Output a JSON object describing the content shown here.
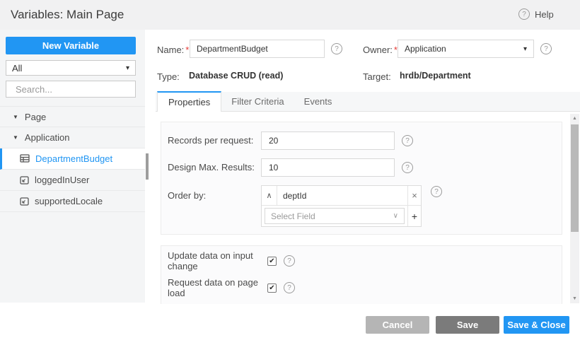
{
  "icons": {
    "question": "?",
    "caret_down": "▾",
    "tree_expanded": "▼",
    "sort_asc": "∧",
    "select_chevron": "∨",
    "remove": "×",
    "add": "+",
    "check": "✔",
    "scroll_up": "▲",
    "scroll_down": "▼"
  },
  "colors": {
    "accent": "#2196f3",
    "cancel_button": "#b5b5b5",
    "save_button": "#7b7b7b"
  },
  "header": {
    "title": "Variables: Main Page",
    "help": "Help"
  },
  "sidebar": {
    "new_variable": "New Variable",
    "filter": {
      "value": "All"
    },
    "search": {
      "placeholder": "Search..."
    },
    "tree": [
      {
        "label": "Page",
        "type": "group"
      },
      {
        "label": "Application",
        "type": "group"
      },
      {
        "label": "DepartmentBudget",
        "type": "variable",
        "selected": true
      },
      {
        "label": "loggedInUser",
        "type": "variable",
        "selected": false
      },
      {
        "label": "supportedLocale",
        "type": "variable",
        "selected": false
      }
    ]
  },
  "variable": {
    "name": {
      "label": "Name:",
      "required": "*",
      "value": "DepartmentBudget"
    },
    "owner": {
      "label": "Owner:",
      "required": "*",
      "value": "Application"
    },
    "type": {
      "label": "Type:",
      "value": "Database CRUD (read)"
    },
    "target": {
      "label": "Target:",
      "value": "hrdb/Department"
    }
  },
  "tabs": [
    {
      "label": "Properties",
      "active": true
    },
    {
      "label": "Filter Criteria",
      "active": false
    },
    {
      "label": "Events",
      "active": false
    }
  ],
  "properties": {
    "records_per_request": {
      "label": "Records per request:",
      "value": "20"
    },
    "design_max_results": {
      "label": "Design Max. Results:",
      "value": "10"
    },
    "order_by": {
      "label": "Order by:",
      "field_value": "deptId",
      "select_placeholder": "Select Field"
    },
    "update_data_on_input_change": {
      "label": "Update data on input change",
      "checked": true
    },
    "request_data_on_page_load": {
      "label": "Request data on page load",
      "checked": true
    }
  },
  "footer": {
    "cancel": "Cancel",
    "save": "Save",
    "save_and_close": "Save & Close"
  }
}
